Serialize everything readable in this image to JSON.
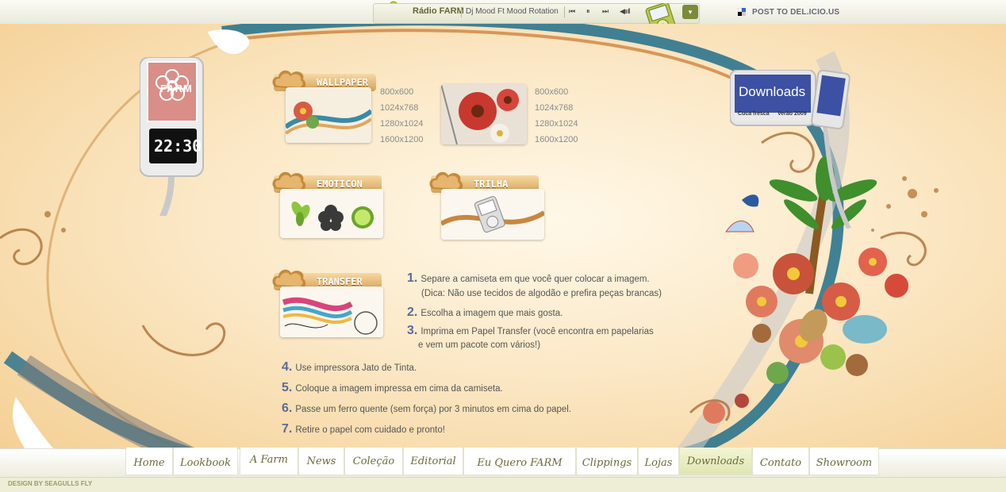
{
  "topbar": {
    "radio_title": "Rádio FARM",
    "track": "Dj Mood Ft Mood Rotation",
    "controls": {
      "prev": "⏮",
      "pause": "⏸",
      "next": "⏭",
      "volume": "◀ıııll"
    },
    "delicious": "POST TO DEL.ICIO.US"
  },
  "sign": {
    "label": "FARM",
    "clock": "22:30"
  },
  "downloads_sign": {
    "title": "Downloads",
    "left_caption": "Cuca fresca",
    "right_caption": "Verão 2009"
  },
  "sections": {
    "wallpaper": "WALLPAPER",
    "emoticon": "EMOTICON",
    "trilha": "TRILHA",
    "transfer": "TRANSFER"
  },
  "wallpaper_sizes_1": [
    "800x600",
    "1024x768",
    "1280x1024",
    "1600x1200"
  ],
  "wallpaper_sizes_2": [
    "800x600",
    "1024x768",
    "1280x1024",
    "1600x1200"
  ],
  "steps": [
    {
      "n": "1.",
      "text": "Separe a camiseta em que você quer colocar a imagem.",
      "sub": "(Dica: Não use tecidos de algodão e prefira peças brancas)"
    },
    {
      "n": "2.",
      "text": "Escolha a imagem que mais gosta.",
      "sub": ""
    },
    {
      "n": "3.",
      "text": "Imprima em Papel Transfer (você encontra em papelarias",
      "sub": "e vem um pacote com vários!)"
    },
    {
      "n": "4.",
      "text": "Use impressora Jato de Tinta.",
      "sub": ""
    },
    {
      "n": "5.",
      "text": "Coloque a imagem impressa em cima da camiseta.",
      "sub": ""
    },
    {
      "n": "6.",
      "text": "Passe um ferro quente (sem força) por 3 minutos em cima do papel.",
      "sub": ""
    },
    {
      "n": "7.",
      "text": "Retire o papel com cuidado e pronto!",
      "sub": ""
    }
  ],
  "nav": [
    "Home",
    "Lookbook",
    "A Farm",
    "News",
    "Coleção",
    "Editorial",
    "Eu Quero FARM",
    "Clippings",
    "Lojas",
    "Downloads",
    "Contato",
    "Showroom"
  ],
  "nav_active": "Downloads",
  "footer": {
    "credit": "DESIGN BY SEAGULLS FLY"
  },
  "colors": {
    "accent": "#d7a156",
    "nav_text": "#6b6b3a",
    "step_number": "#5a6b9a",
    "bg": "#f6e6c9"
  }
}
